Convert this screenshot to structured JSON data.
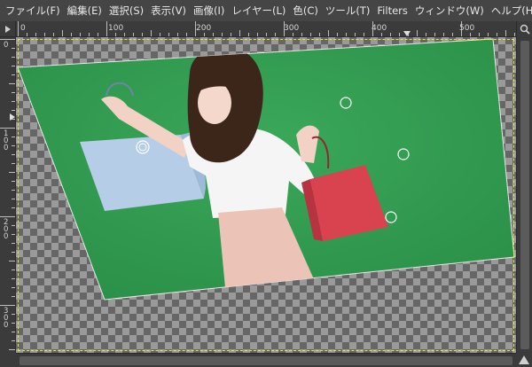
{
  "menu": {
    "items": [
      {
        "id": "file",
        "label": "ファイル(F)"
      },
      {
        "id": "edit",
        "label": "編集(E)"
      },
      {
        "id": "select",
        "label": "選択(S)"
      },
      {
        "id": "view",
        "label": "表示(V)"
      },
      {
        "id": "image",
        "label": "画像(I)"
      },
      {
        "id": "layer",
        "label": "レイヤー(L)"
      },
      {
        "id": "color",
        "label": "色(C)"
      },
      {
        "id": "tools",
        "label": "ツール(T)"
      },
      {
        "id": "filters",
        "label": "Filters"
      },
      {
        "id": "windows",
        "label": "ウィンドウ(W)"
      },
      {
        "id": "help",
        "label": "ヘルプ(H)"
      }
    ]
  },
  "ruler": {
    "horizontal_labels": [
      "0",
      "100",
      "200",
      "300",
      "400",
      "500"
    ],
    "vertical_labels": [
      "0",
      "100",
      "200",
      "300"
    ]
  },
  "canvas": {
    "layer_colors": {
      "green": "#2f9a4e",
      "bag_blue": "#b4cce6",
      "bag_red": "#d8424f",
      "skirt": "#ebc2b6",
      "blouse": "#f3f3f3",
      "hair": "#3b2418"
    },
    "handles": [
      {
        "name": "transform-handle-top-right"
      },
      {
        "name": "transform-handle-center"
      },
      {
        "name": "transform-handle-right"
      },
      {
        "name": "transform-handle-bottom-right"
      }
    ]
  },
  "icons": {
    "ruler_corner": "triangle-right-icon",
    "zoom": "magnifier-icon",
    "navigate": "navigate-icon"
  }
}
